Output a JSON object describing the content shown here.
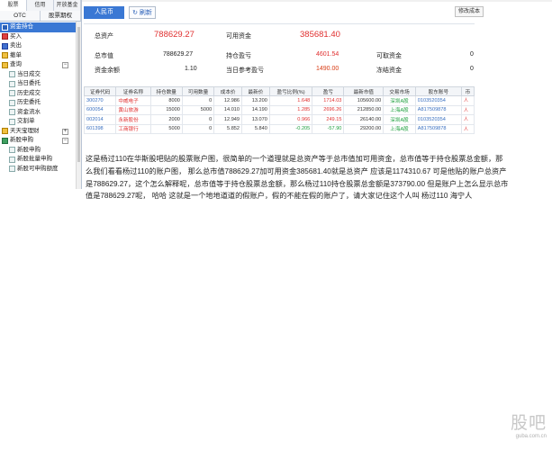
{
  "left_panel": {
    "tabs_row1": [
      "股票",
      "信用",
      "开放基金"
    ],
    "tabs_row2": [
      "OTC",
      "股票期权"
    ],
    "tree": [
      {
        "label": "资金持仓",
        "icon": "holdings-icon",
        "selected": true
      },
      {
        "label": "买入",
        "icon": "buy-icon"
      },
      {
        "label": "卖出",
        "icon": "sell-icon"
      },
      {
        "label": "撤单",
        "icon": "cancel-order-icon"
      },
      {
        "label": "查询",
        "icon": "query-folder-icon",
        "expand": "−"
      },
      {
        "label": "当日成交",
        "icon": "doc-icon",
        "sub": true
      },
      {
        "label": "当日委托",
        "icon": "doc-icon",
        "sub": true
      },
      {
        "label": "历史成交",
        "icon": "doc-icon",
        "sub": true
      },
      {
        "label": "历史委托",
        "icon": "doc-icon",
        "sub": true
      },
      {
        "label": "资金流水",
        "icon": "doc-icon",
        "sub": true
      },
      {
        "label": "交割单",
        "icon": "doc-icon",
        "sub": true
      },
      {
        "label": "天天宝理财",
        "icon": "wealth-folder-icon",
        "expand": "+"
      },
      {
        "label": "新股申购",
        "icon": "ipo-folder-icon",
        "expand": "−"
      },
      {
        "label": "新股申购",
        "icon": "doc-icon",
        "sub": true
      },
      {
        "label": "新股批量申购",
        "icon": "doc-icon",
        "sub": true
      },
      {
        "label": "新股可申购额度",
        "icon": "doc-icon",
        "sub": true
      }
    ]
  },
  "toolbar": {
    "currency_tab": "人民币",
    "refresh_label": "刷新",
    "right_button": "修改成本"
  },
  "summary": {
    "total_assets_label": "总资产",
    "total_assets_value": "788629.27",
    "available_funds_label": "可用资金",
    "available_funds_value": "385681.40",
    "market_value_label": "总市值",
    "market_value_value": "788629.27",
    "position_pnl_label": "持仓盈亏",
    "position_pnl_value": "4601.54",
    "withdrawable_label": "可取资金",
    "withdrawable_value": "0",
    "fund_balance_label": "资金余额",
    "fund_balance_value": "1.10",
    "today_pnl_label": "当日参考盈亏",
    "today_pnl_value": "1490.00",
    "frozen_label": "冻结资金",
    "frozen_value": "0"
  },
  "table": {
    "headers": [
      "证券代码",
      "证券名称",
      "持仓数量",
      "可用数量",
      "成本价",
      "最新价",
      "盈亏比例(%)",
      "盈亏",
      "最新市值",
      "交易市场",
      "股东账号",
      "币"
    ],
    "rows": [
      [
        "300270",
        "中威电子",
        "8000",
        "0",
        "12.986",
        "13.200",
        "1.648",
        "1714.03",
        "105600.00",
        "深圳A股",
        "0103520354",
        "人"
      ],
      [
        "600054",
        "黄山旅游",
        "15000",
        "5000",
        "14.010",
        "14.190",
        "1.285",
        "2696.26",
        "212850.00",
        "上海A股",
        "A817509878",
        "人"
      ],
      [
        "002014",
        "永新股份",
        "2000",
        "0",
        "12.949",
        "13.070",
        "0.966",
        "249.15",
        "26140.00",
        "深圳A股",
        "0103520354",
        "人"
      ],
      [
        "601398",
        "工商银行",
        "5000",
        "0",
        "5.852",
        "5.840",
        "-0.205",
        "-57.90",
        "29200.00",
        "上海A股",
        "A817509878",
        "人"
      ]
    ]
  },
  "commentary": "这是杨过110在华斯股吧贴的股票账户图，很简单的一个道理就是总资产等于总市值加可用资金，总市值等于持仓股票总金额，那么我们看看杨过110的账户图， 那么总市值788629.27加可用资金385681.40就是总资产 应该是1174310.67 可是他贴的账户总资产是788629.27，这个怎么解释呢，总市值等于持仓股票总金额，那么杨过110持仓股票总金额是373790.00 但是账户上怎么显示总市值是788629.27呢， 哈哈 这就是一个地地道道的假账户，假的不能在假的账户了，请大家记住这个人叫 杨过110  海宁人",
  "watermark": {
    "logo": "股吧",
    "url": "guba.com.cn"
  },
  "colors": {
    "accent_blue": "#3a78d4",
    "value_red": "#e03030",
    "value_green": "#20a040",
    "value_orange": "#d83c14"
  }
}
